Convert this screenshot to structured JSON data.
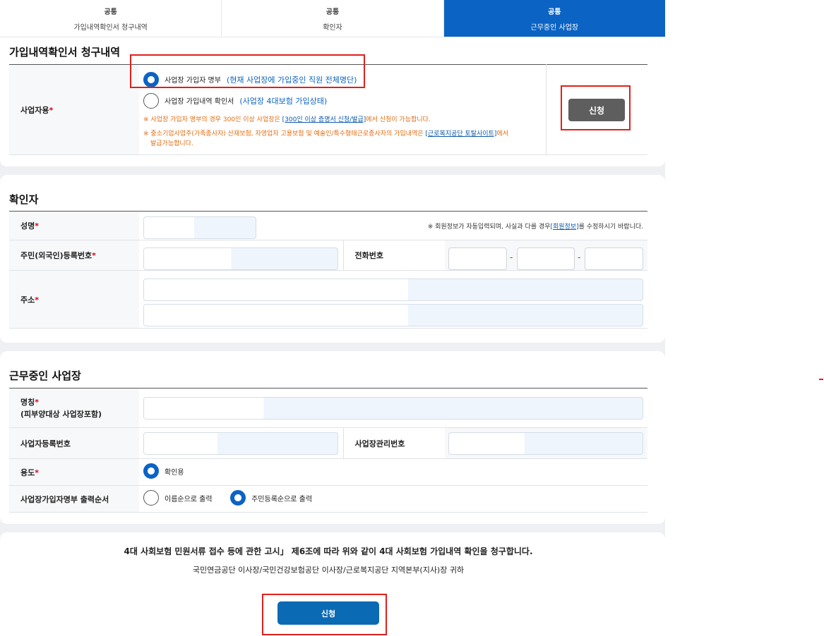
{
  "tabs": [
    {
      "line1": "공통",
      "line2": "가입내역확인서 청구내역",
      "active": false
    },
    {
      "line1": "공통",
      "line2": "확인자",
      "active": false
    },
    {
      "line1": "공통",
      "line2": "근무중인 사업장",
      "active": true
    }
  ],
  "section1": {
    "title": "가입내역확인서 청구내역",
    "row_label": "사업자용",
    "required_mark": "*",
    "option1_label": "사업장 가입자 명부",
    "option1_desc": "(현재 사업장에 가입중인 직원 전체명단)",
    "option2_label": "사업장 가입내역 확인서",
    "option2_desc": "(사업장 4대보험 가입상태)",
    "note1_prefix": "※ 사업장 가입자 명부의 경우 300인 이상 사업장은",
    "note1_link": "[300인 이상 증명서 신청/발급]",
    "note1_suffix": "에서 신청이 가능합니다.",
    "note2_prefix": "※ 중소기업사업주(가족종사자) 산재보험, 자영업자 고용보험 및 예술인/특수형태근로종사자의 가입내역은",
    "note2_link": "[근로복지공단 토탈사이트]",
    "note2_suffix": "에서",
    "note2_line2": "발급가능합니다.",
    "apply_button": "신청"
  },
  "section2": {
    "title": "확인자",
    "name_label": "성명",
    "notice_prefix": "※ 회원정보가 자동입력되며, 사실과 다를 경우",
    "notice_link": "[회원정보]",
    "notice_suffix": "를 수정하시기 바랍니다.",
    "rrn_label": "주민(외국인)등록번호",
    "phone_label": "전화번호",
    "phone_sep1": "-",
    "phone_sep2": "-",
    "address_label": "주소",
    "required_mark": "*"
  },
  "section3": {
    "title": "근무중인 사업장",
    "name_label": "명칭",
    "name_sub": "(피부양대상 사업장포함)",
    "bizno_label": "사업자등록번호",
    "mgmt_label": "사업장관리번호",
    "purpose_label": "용도",
    "purpose_option": "확인용",
    "order_label": "사업장가입자명부 출력순서",
    "order_option1": "이름순으로 출력",
    "order_option2": "주민등록순으로 출력",
    "required_mark": "*"
  },
  "footer": {
    "statement": "4대 사회보험 민원서류 접수 등에 관한 고시」 제6조에 따라 위와 같이 4대 사회보험 가입내역 확인을 청구합니다.",
    "recipients": "국민연금공단 이사장/국민건강보험공단 이사장/근로복지공단 지역본부(지사)장 귀하",
    "submit_button": "신청"
  },
  "colors": {
    "primary": "#0b63c4",
    "highlight_box": "#e0201b",
    "note": "#e36b10"
  }
}
